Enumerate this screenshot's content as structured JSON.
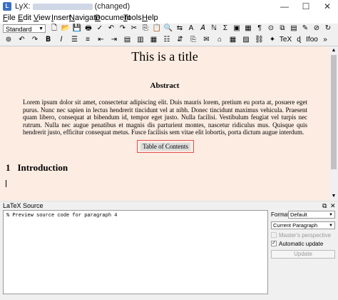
{
  "titlebar": {
    "app": "LyX:",
    "status": "(changed)",
    "minimize": "—",
    "maximize": "☐",
    "close": "✕"
  },
  "menu": [
    "File",
    "Edit",
    "View",
    "Insert",
    "Navigate",
    "Document",
    "Tools",
    "Help"
  ],
  "menu_access": [
    "F",
    "E",
    "V",
    "I",
    "N",
    "D",
    "T",
    "H"
  ],
  "toolbar": {
    "paragraph_style": "Standard",
    "icons_row1": [
      "new-doc-icon",
      "open-icon",
      "save-icon",
      "print-icon",
      "check-icon",
      "undo-icon",
      "redo-icon",
      "cut-icon",
      "copy-icon",
      "paste-icon",
      "find-icon",
      "find-replace-icon",
      "text-style-icon",
      "emphasis-icon",
      "noun-icon",
      "math-icon",
      "figure-icon",
      "table-icon",
      "label-icon",
      "cross-ref-icon",
      "citation-icon",
      "index-icon",
      "spellcheck-icon",
      "view-pdf-icon",
      "update-icon"
    ],
    "glyphs_row1": [
      "🗋",
      "📂",
      "💾",
      "🖶",
      "✓",
      "↶",
      "↷",
      "✂",
      "⎘",
      "📋",
      "🔍",
      "⇆",
      "A",
      "𝐴",
      "ℕ",
      "Σ",
      "▣",
      "▦",
      "¶",
      "⊙",
      "⧉",
      "▤",
      "✎",
      "⊘",
      "↻"
    ],
    "icons_row2": [
      "binoculars-icon",
      "undo2-icon",
      "redo2-icon",
      "bold-icon",
      "italic-icon",
      "list-icon",
      "enum-icon",
      "depth-dec-icon",
      "depth-inc-icon",
      "align-left-icon",
      "align-right-icon",
      "align-center-icon",
      "outline-icon",
      "toggle-icon",
      "paste2-icon",
      "note-icon",
      "tag-icon",
      "table2-icon",
      "image-icon",
      "link-icon",
      "texstudio-icon",
      "tex-icon",
      "dvi-icon",
      "ifoo-icon",
      "more-icon"
    ],
    "glyphs_row2": [
      "⊚",
      "↶",
      "↷",
      "𝐁",
      "𝐼",
      "☰",
      "≡",
      "⇤",
      "⇥",
      "▤",
      "▥",
      "▦",
      "☷",
      "⇵",
      "⎘",
      "✉",
      "⌂",
      "▦",
      "▨",
      "⛓",
      "✦",
      "TeX",
      "ɖ",
      "Ifoo",
      "»"
    ]
  },
  "document": {
    "title": "This is a title",
    "abstract_heading": "Abstract",
    "abstract_text": "Lorem ipsum dolor sit amet, consectetur adipiscing elit. Duis mauris lorem, pretium eu porta at, posuere eget purus. Nunc nec sapien in lectus hendrerit tincidunt vel at nibh. Donec tincidunt maximus vehicula. Praesent quam libero, consequat at bibendum id, tempor eget justo. Nulla facilisi. Vestibulum feugiat vel turpis nec rutrum. Nulla nec augue penatibus et magnis dis parturient montes, nascetur ridiculus mus. Quisque quis hendrerit justo, efficitur consequat metus. Fusce facilisis sem vitae elit lobortis, porta dictum augue interdum.",
    "toc_label": "Table of Contents",
    "section_number": "1",
    "section_title": "Introduction"
  },
  "latex_panel": {
    "title": "LaTeX Source",
    "source_text": "% Preview source code for paragraph 4",
    "format_label": "Format:",
    "format_value": "Default",
    "scope_value": "Current Paragraph",
    "masters_perspective": "Master's perspective",
    "automatic_update": "Automatic update",
    "update_button": "Update",
    "automatic_update_checked": true
  },
  "colors": {
    "editor_bg": "#fcece2",
    "toc_highlight": "#e05050"
  }
}
